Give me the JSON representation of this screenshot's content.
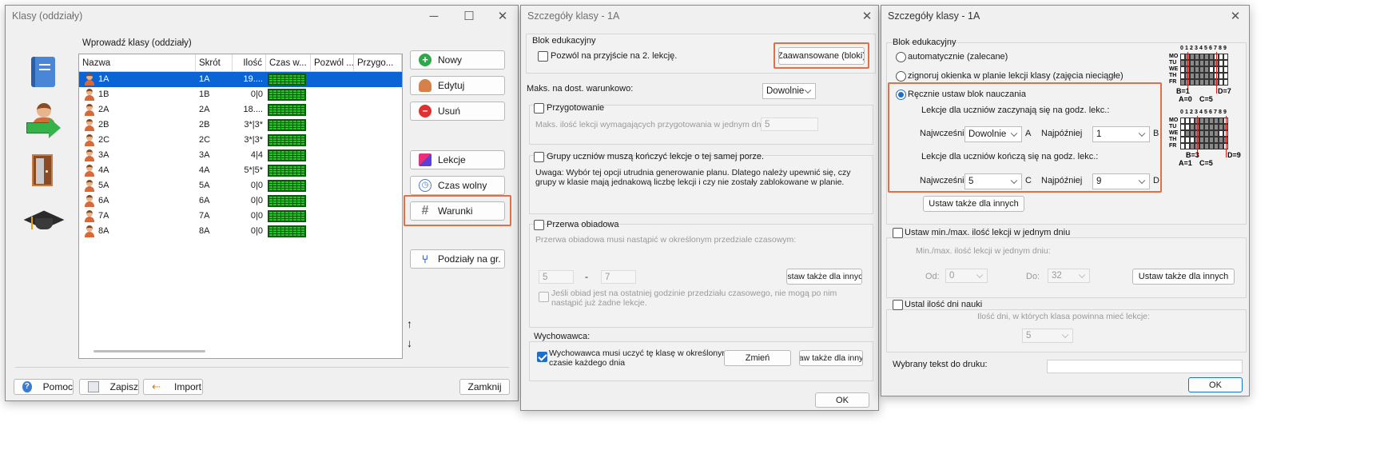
{
  "w1": {
    "title": "Klasy (oddziały)",
    "table_title": "Wprowadź klasy (oddziały)",
    "columns": [
      "Nazwa",
      "Skrót",
      "Ilość",
      "Czas w...",
      "Pozwól ...",
      "Przygo..."
    ],
    "rows": [
      {
        "name": "1A",
        "short": "1A",
        "qty": "19...."
      },
      {
        "name": "1B",
        "short": "1B",
        "qty": "0|0"
      },
      {
        "name": "2A",
        "short": "2A",
        "qty": "18...."
      },
      {
        "name": "2B",
        "short": "2B",
        "qty": "3*|3*"
      },
      {
        "name": "2C",
        "short": "2C",
        "qty": "3*|3*"
      },
      {
        "name": "3A",
        "short": "3A",
        "qty": "4|4"
      },
      {
        "name": "4A",
        "short": "4A",
        "qty": "5*|5*"
      },
      {
        "name": "5A",
        "short": "5A",
        "qty": "0|0"
      },
      {
        "name": "6A",
        "short": "6A",
        "qty": "0|0"
      },
      {
        "name": "7A",
        "short": "7A",
        "qty": "0|0"
      },
      {
        "name": "8A",
        "short": "8A",
        "qty": "0|0"
      }
    ],
    "buttons": {
      "new": "Nowy",
      "edit": "Edytuj",
      "delete": "Usuń",
      "lessons": "Lekcje",
      "free_time": "Czas wolny",
      "conditions": "Warunki",
      "divisions": "Podziały na gr."
    },
    "bottom": {
      "help": "Pomoc",
      "save": "Zapisz",
      "import": "Import",
      "close": "Zamknij"
    },
    "arrows": {
      "up": "↑",
      "down": "↓"
    }
  },
  "w2": {
    "title": "Szczegóły klasy - 1A",
    "blok_title": "Blok edukacyjny",
    "allow_2nd": "Pozwól na przyjście na 2. lekcję.",
    "advanced": "Zaawansowane (bloki)",
    "max_cond_label": "Maks. na dost. warunkowo:",
    "max_cond_value": "Dowolnie",
    "prep_label": "Przygotowanie",
    "prep_desc": "Maks. ilość lekcji wymagających przygotowania w jednym dniu",
    "prep_value": "5",
    "groups_label": "Grupy uczniów muszą kończyć lekcje o tej samej porze.",
    "groups_note_1": "Uwaga: Wybór tej opcji utrudnia generowanie planu. Dlatego należy upewnić się, czy",
    "groups_note_2": "grupy w klasie mają jednakową liczbę lekcji i czy nie zostały zablokowane w planie.",
    "lunch_label": "Przerwa obiadowa",
    "lunch_desc": "Przerwa obiadowa musi nastąpić w określonym przedziale czasowym:",
    "lunch_from": "5",
    "lunch_dash": "-",
    "lunch_to": "7",
    "lunch_set_others": "Ustaw także dla innych",
    "lunch_note_1": "Jeśli obiad jest na ostatniej godzinie przedziału czasowego, nie mogą po nim",
    "lunch_note_2": "nastąpić już żadne lekcje.",
    "teacher_title": "Wychowawca:",
    "teacher_label_1": "Wychowawca musi uczyć tę klasę w określonym",
    "teacher_label_2": "czasie każdego dnia",
    "change": "Zmień",
    "set_others2": "aw także dla inny",
    "ok": "OK"
  },
  "w3": {
    "title": "Szczegóły klasy - 1A",
    "blok_title": "Blok edukacyjny",
    "auto": "automatycznie (zalecane)",
    "ignore": "zignoruj okienka w planie lekcji klasy (zajęcia nieciągłe)",
    "manual": "Ręcznie ustaw blok nauczania",
    "start_label": "Lekcje dla uczniów zaczynają się na godz. lekc.:",
    "earliest": "Najwcześniej",
    "latest": "Najpóźniej",
    "start_a": "Dowolnie",
    "start_a_letter": "A",
    "start_b": "1",
    "start_b_letter": "B",
    "end_label": "Lekcje dla uczniów kończą się na godz. lekc.:",
    "end_c": "5",
    "end_c_letter": "C",
    "end_d": "9",
    "end_d_letter": "D",
    "set_others": "Ustaw także dla innych",
    "minmax_label": "Ustaw min./max. ilość lekcji w jednym dniu",
    "minmax_desc": "Min./max. ilość lekcji w jednym dniu:",
    "from_label": "Od:",
    "from_value": "0",
    "to_label": "Do:",
    "to_value": "32",
    "set_others_b": "Ustaw także dla innych",
    "days_label": "Ustal ilość dni nauki",
    "days_desc": "Ilość dni, w których klasa powinna mieć lekcje:",
    "days_value": "5",
    "print_label": "Wybrany tekst do druku:",
    "ok": "OK",
    "diagram": {
      "days": [
        "MO",
        "TU",
        "WE",
        "TH",
        "FR"
      ],
      "hours": "0123456789",
      "d1_left": "B=1",
      "d1_right": "D=7",
      "d1_a": "A=0",
      "d1_c": "C=5",
      "d2_left": "B=3",
      "d2_right": "D=9",
      "d2_a": "A=1",
      "d2_c": "C=5"
    }
  },
  "colors": {
    "highlight": "#e07048",
    "selection": "#0a64d6",
    "grid_green": "#24c424",
    "accent_blue": "#1f6fc6"
  }
}
